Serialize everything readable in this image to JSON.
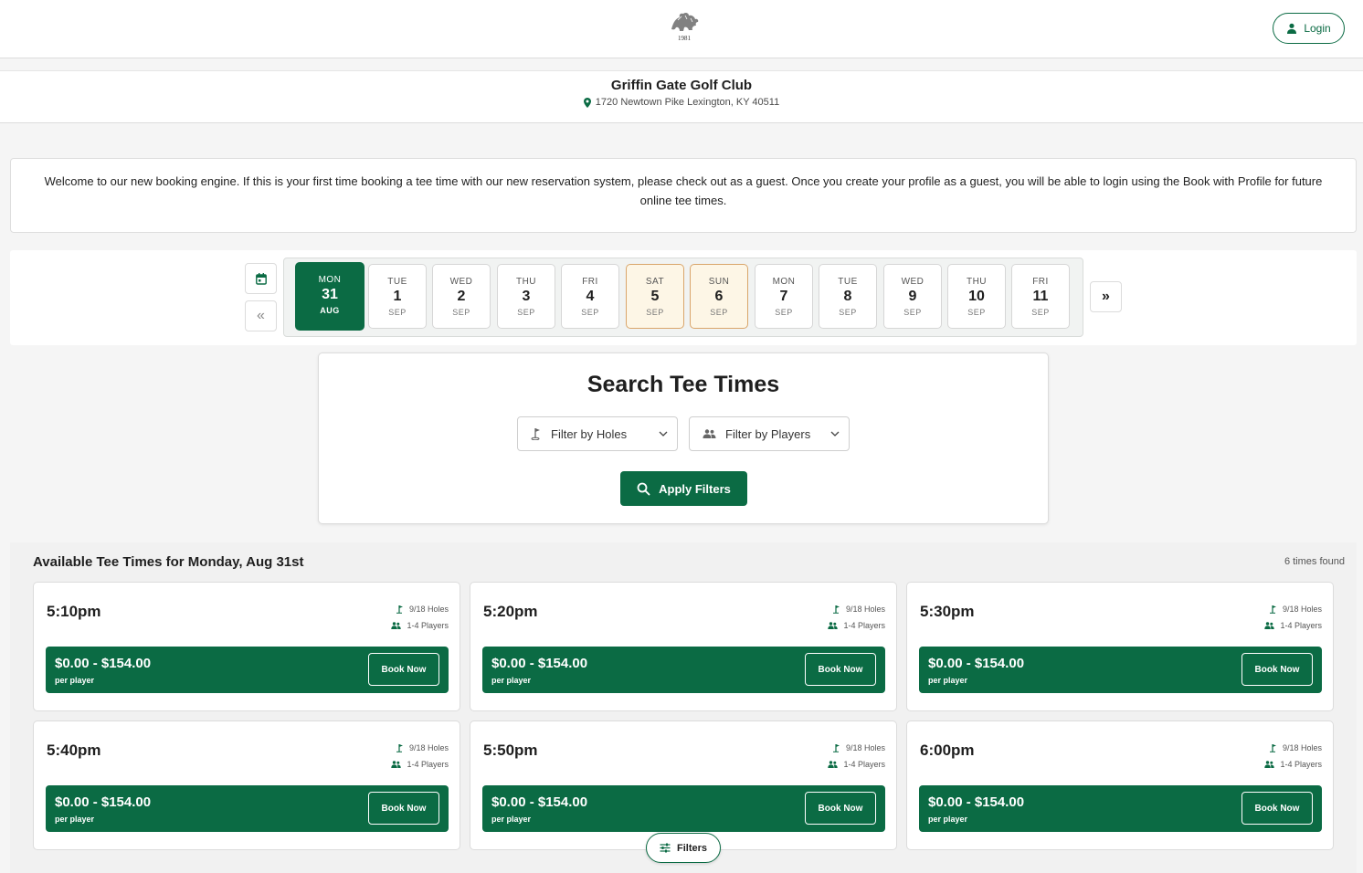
{
  "header": {
    "logo_year": "1981",
    "login_label": "Login"
  },
  "club": {
    "name": "Griffin Gate Golf Club",
    "address": "1720 Newtown Pike Lexington, KY 40511"
  },
  "welcome_message": "Welcome to our new booking engine.  If this is your first time booking a tee time with our new reservation system, please check out as a guest.  Once you create your profile as a guest, you will be able to login using the Book with Profile for future online tee times.",
  "date_picker": {
    "prev_label": "«",
    "next_label": "»",
    "dates": [
      {
        "dow": "MON",
        "day": "31",
        "month": "AUG",
        "selected": true
      },
      {
        "dow": "TUE",
        "day": "1",
        "month": "SEP"
      },
      {
        "dow": "WED",
        "day": "2",
        "month": "SEP"
      },
      {
        "dow": "THU",
        "day": "3",
        "month": "SEP"
      },
      {
        "dow": "FRI",
        "day": "4",
        "month": "SEP"
      },
      {
        "dow": "SAT",
        "day": "5",
        "month": "SEP",
        "weekend": true
      },
      {
        "dow": "SUN",
        "day": "6",
        "month": "SEP",
        "weekend": true
      },
      {
        "dow": "MON",
        "day": "7",
        "month": "SEP"
      },
      {
        "dow": "TUE",
        "day": "8",
        "month": "SEP"
      },
      {
        "dow": "WED",
        "day": "9",
        "month": "SEP"
      },
      {
        "dow": "THU",
        "day": "10",
        "month": "SEP"
      },
      {
        "dow": "FRI",
        "day": "11",
        "month": "SEP"
      }
    ]
  },
  "search": {
    "title": "Search Tee Times",
    "holes_filter": "Filter by Holes",
    "players_filter": "Filter by Players",
    "apply_label": "Apply Filters"
  },
  "results": {
    "title": "Available Tee Times for Monday, Aug 31st",
    "count": "6 times found",
    "tee_times": [
      {
        "time": "5:10pm",
        "holes": "9/18 Holes",
        "players": "1-4 Players",
        "price": "$0.00 - $154.00",
        "per": "per player",
        "book": "Book Now"
      },
      {
        "time": "5:20pm",
        "holes": "9/18 Holes",
        "players": "1-4 Players",
        "price": "$0.00 - $154.00",
        "per": "per player",
        "book": "Book Now"
      },
      {
        "time": "5:30pm",
        "holes": "9/18 Holes",
        "players": "1-4 Players",
        "price": "$0.00 - $154.00",
        "per": "per player",
        "book": "Book Now"
      },
      {
        "time": "5:40pm",
        "holes": "9/18 Holes",
        "players": "1-4 Players",
        "price": "$0.00 - $154.00",
        "per": "per player",
        "book": "Book Now"
      },
      {
        "time": "5:50pm",
        "holes": "9/18 Holes",
        "players": "1-4 Players",
        "price": "$0.00 - $154.00",
        "per": "per player",
        "book": "Book Now"
      },
      {
        "time": "6:00pm",
        "holes": "9/18 Holes",
        "players": "1-4 Players",
        "price": "$0.00 - $154.00",
        "per": "per player",
        "book": "Book Now"
      }
    ]
  },
  "floating_filters_label": "Filters",
  "colors": {
    "brand_green": "#0b6b44",
    "weekend_bg": "#fdf6e6",
    "weekend_border": "#d9a56a"
  }
}
